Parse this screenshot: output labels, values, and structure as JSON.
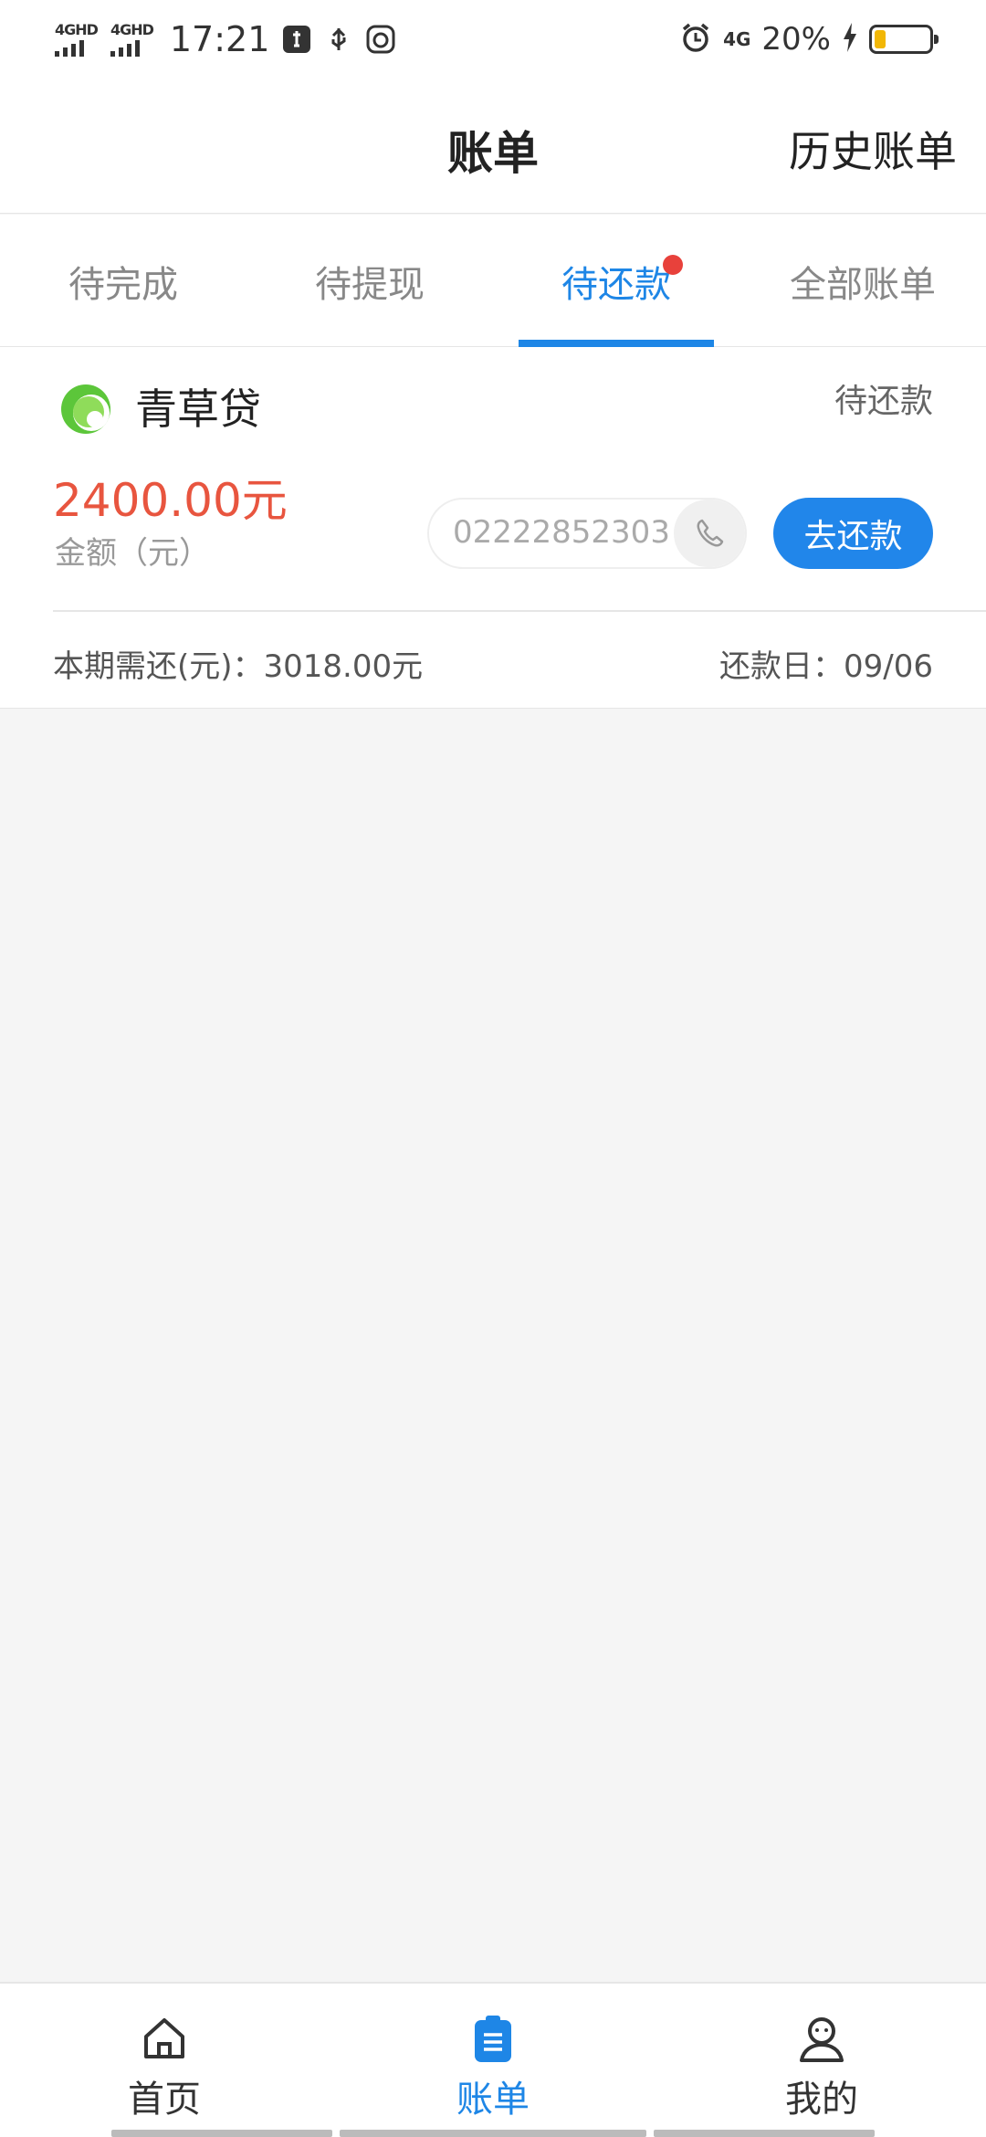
{
  "status_bar": {
    "sim1_label": "4GHD",
    "sim2_label": "4GHD",
    "time": "17:21",
    "network": "4G",
    "battery_percent": "20%",
    "battery_level": 0.2,
    "battery_fill_color": "#f2b705"
  },
  "header": {
    "title": "账单",
    "history_link": "历史账单"
  },
  "tabs": [
    {
      "label": "待完成",
      "active": false
    },
    {
      "label": "待提现",
      "active": false
    },
    {
      "label": "待还款",
      "active": true,
      "has_badge_dot": true
    },
    {
      "label": "全部账单",
      "active": false
    }
  ],
  "bill_card": {
    "lender_name": "青草贷",
    "status": "待还款",
    "amount": "2400.00元",
    "amount_label": "金额（元）",
    "phone_number": "02222852303",
    "repay_button": "去还款",
    "due_amount_text": "本期需还(元)：3018.00元",
    "due_date_text": "还款日：09/06"
  },
  "bottom_nav": [
    {
      "label": "首页",
      "icon": "home-icon",
      "active": false
    },
    {
      "label": "账单",
      "icon": "bill-icon",
      "active": true
    },
    {
      "label": "我的",
      "icon": "profile-icon",
      "active": false
    }
  ],
  "colors": {
    "accent": "#1e86e6",
    "amount_red": "#e8553f",
    "badge_red": "#e8413b"
  }
}
